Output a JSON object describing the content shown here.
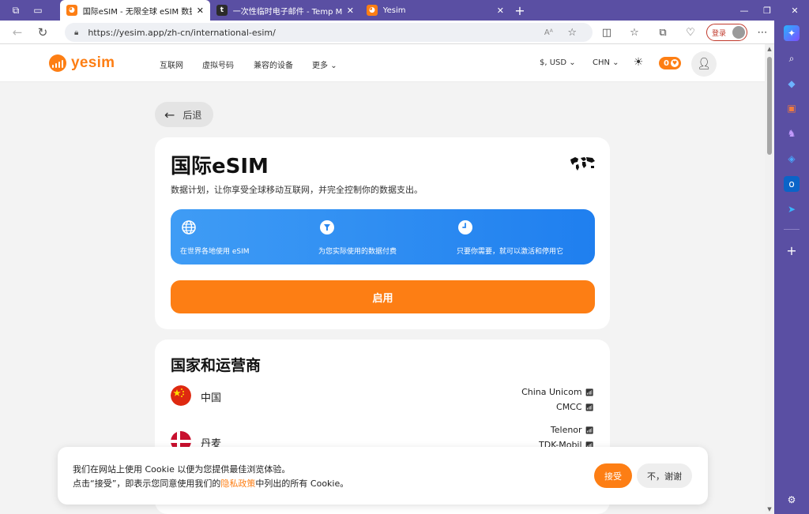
{
  "browser": {
    "tabs": [
      {
        "title": "国际eSIM - 无限全球 eSIM 数据计划",
        "favicon": "yesim-favicon",
        "active": true
      },
      {
        "title": "一次性临时电子邮件 - Temp Mail",
        "favicon": "t",
        "active": false
      },
      {
        "title": "Yesim",
        "favicon": "yesim-favicon",
        "active": false
      }
    ],
    "url": "https://yesim.app/zh-cn/international-esim/",
    "signin_label": "登录",
    "colors": {
      "frame": "#5a4fa3",
      "accent": "#fd7e14"
    }
  },
  "header": {
    "logo_text": "yesim",
    "nav": [
      "互联网",
      "虚拟号码",
      "兼容的设备",
      "更多"
    ],
    "currency": "$, USD",
    "language": "CHN",
    "coins": "0"
  },
  "main": {
    "back_label": "后退",
    "title": "国际eSIM",
    "subtitle": "数据计划，让你享受全球移动互联网，并完全控制你的数据支出。",
    "features": [
      {
        "icon": "globe-icon",
        "label": "在世界各地使用 eSIM"
      },
      {
        "icon": "filter-icon",
        "label": "为您实际使用的数据付费"
      },
      {
        "icon": "clock-icon",
        "label": "只要你需要，就可以激活和停用它"
      }
    ],
    "start_label": "启用"
  },
  "countries": {
    "title": "国家和运营商",
    "items": [
      {
        "name": "中国",
        "flag": "cn-flag",
        "operators": [
          "China Unicom",
          "CMCC"
        ]
      },
      {
        "name": "丹麦",
        "flag": "dk-flag",
        "operators": [
          "Telenor",
          "TDK-Mobil"
        ]
      }
    ]
  },
  "cookie": {
    "line1": "我们在网站上使用 Cookie 以便为您提供最佳浏览体验。",
    "line2_prefix": "点击“接受”，即表示您同意使用我们的",
    "link": "隐私政策",
    "line2_suffix": "中列出的所有 Cookie。",
    "accept": "接受",
    "decline": "不，谢谢"
  }
}
